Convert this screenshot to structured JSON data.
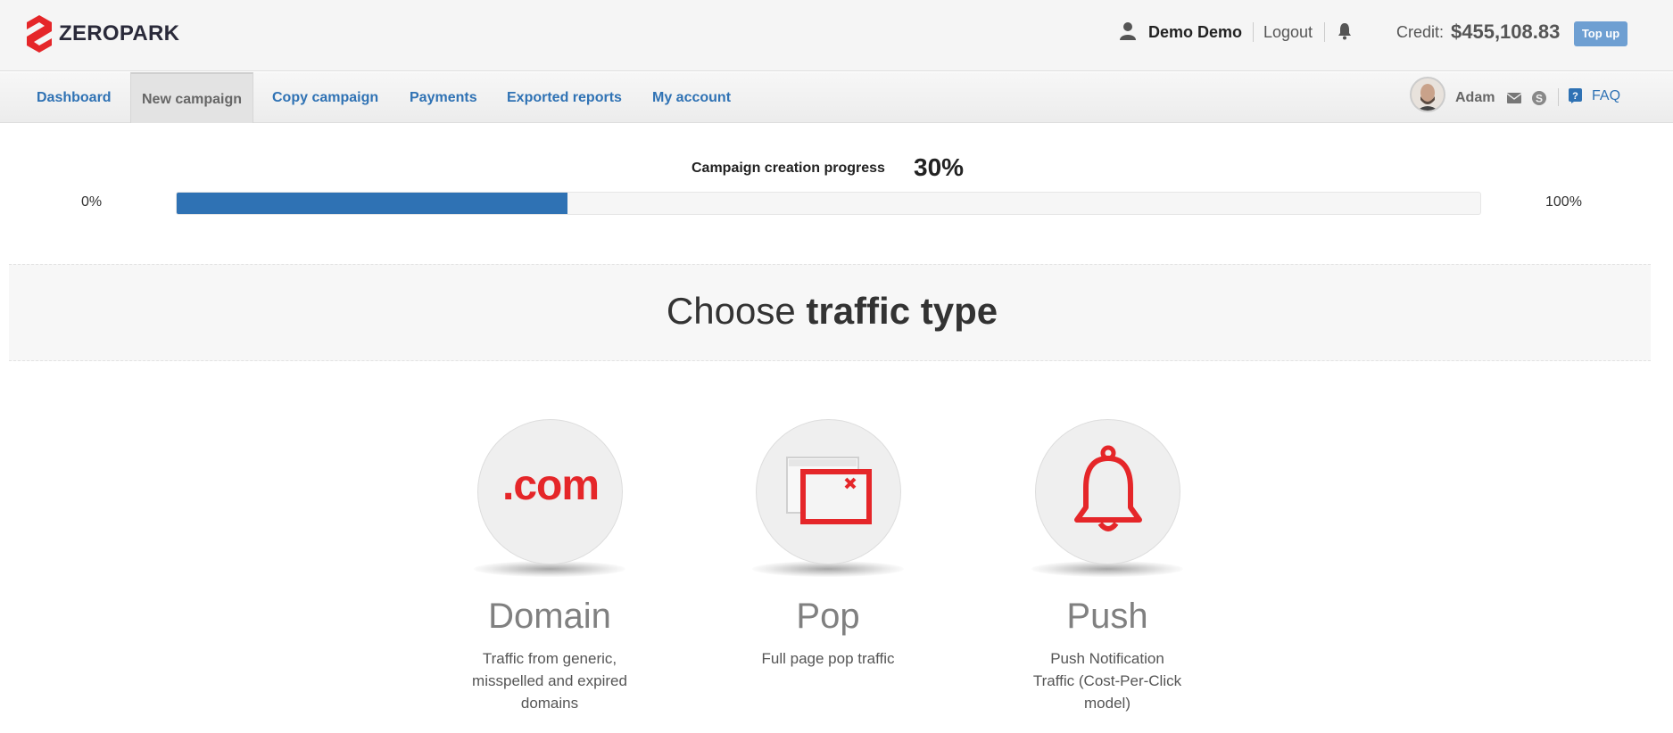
{
  "header": {
    "logo_text": "ZEROPARK",
    "user_name": "Demo Demo",
    "logout_label": "Logout",
    "credit_label": "Credit:",
    "credit_value": "$455,108.83",
    "topup_label": "Top up"
  },
  "nav": {
    "items": [
      {
        "label": "Dashboard"
      },
      {
        "label": "New campaign",
        "active": true
      },
      {
        "label": "Copy campaign"
      },
      {
        "label": "Payments"
      },
      {
        "label": "Exported reports"
      },
      {
        "label": "My account"
      }
    ],
    "account_manager": "Adam",
    "faq_label": "FAQ"
  },
  "progress": {
    "title": "Campaign creation progress",
    "percent_label": "30%",
    "value": 0.3,
    "min_label": "0%",
    "max_label": "100%"
  },
  "section": {
    "title_regular": "Choose ",
    "title_bold": "traffic type"
  },
  "traffic_types": [
    {
      "title": "Domain",
      "description": "Traffic from generic, misspelled and expired domains",
      "icon_text": ".com",
      "icon": "dotcom-icon"
    },
    {
      "title": "Pop",
      "description": "Full page pop traffic",
      "icon": "popup-window-icon"
    },
    {
      "title": "Push",
      "description": "Push Notification Traffic (Cost-Per-Click model)",
      "icon": "bell-icon"
    }
  ],
  "colors": {
    "brand_red": "#e52629",
    "link_blue": "#2f72b4",
    "progress_fill": "#2f72b4",
    "topup_button": "#6e9fd2"
  }
}
